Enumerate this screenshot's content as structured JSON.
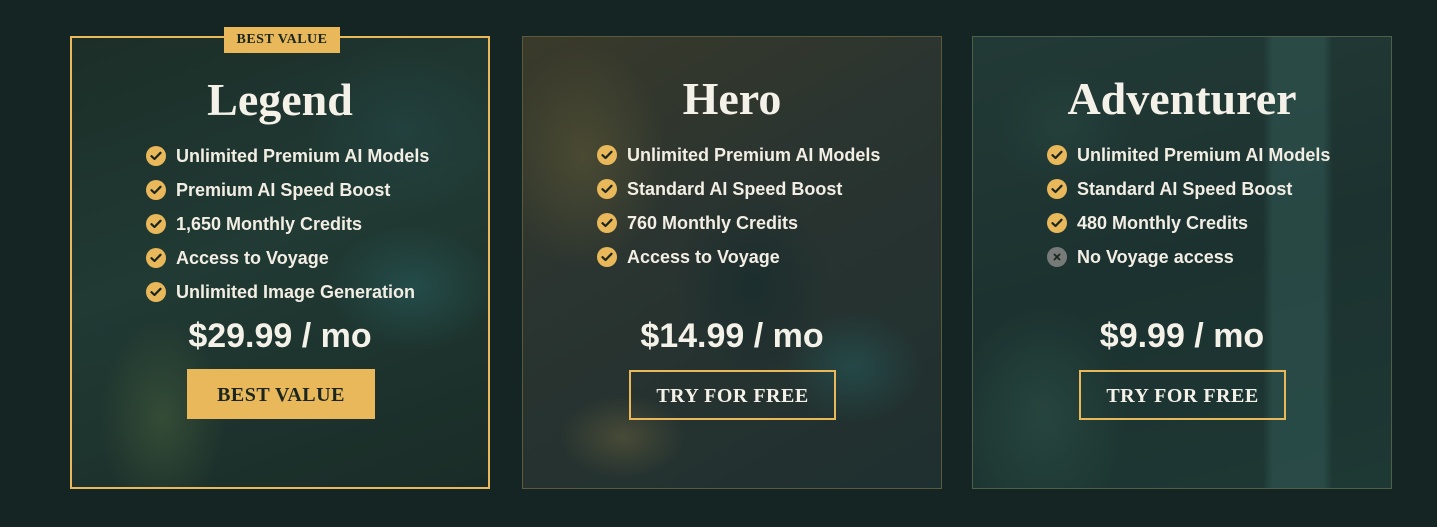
{
  "colors": {
    "page_background": "#142523",
    "accent_gold": "#e8b85a",
    "text_light": "#f4f1e8",
    "cross_icon_gray": "#767a78"
  },
  "plans": [
    {
      "badge": "BEST VALUE",
      "title": "Legend",
      "features": [
        {
          "label": "Unlimited Premium AI Models",
          "included": true,
          "icon": "check-icon"
        },
        {
          "label": "Premium AI Speed Boost",
          "included": true,
          "icon": "check-icon"
        },
        {
          "label": "1,650 Monthly Credits",
          "included": true,
          "icon": "check-icon"
        },
        {
          "label": "Access to Voyage",
          "included": true,
          "icon": "check-icon"
        },
        {
          "label": "Unlimited Image Generation",
          "included": true,
          "icon": "check-icon"
        }
      ],
      "price": "$29.99 / mo",
      "cta_label": "BEST VALUE"
    },
    {
      "title": "Hero",
      "features": [
        {
          "label": "Unlimited Premium AI Models",
          "included": true,
          "icon": "check-icon"
        },
        {
          "label": "Standard AI Speed Boost",
          "included": true,
          "icon": "check-icon"
        },
        {
          "label": "760 Monthly Credits",
          "included": true,
          "icon": "check-icon"
        },
        {
          "label": "Access to Voyage",
          "included": true,
          "icon": "check-icon"
        }
      ],
      "price": "$14.99 / mo",
      "cta_label": "TRY FOR FREE"
    },
    {
      "title": "Adventurer",
      "features": [
        {
          "label": "Unlimited Premium AI Models",
          "included": true,
          "icon": "check-icon"
        },
        {
          "label": "Standard AI Speed Boost",
          "included": true,
          "icon": "check-icon"
        },
        {
          "label": "480 Monthly Credits",
          "included": true,
          "icon": "check-icon"
        },
        {
          "label": "No Voyage access",
          "included": false,
          "icon": "cross-icon"
        }
      ],
      "price": "$9.99 / mo",
      "cta_label": "TRY FOR FREE"
    }
  ]
}
